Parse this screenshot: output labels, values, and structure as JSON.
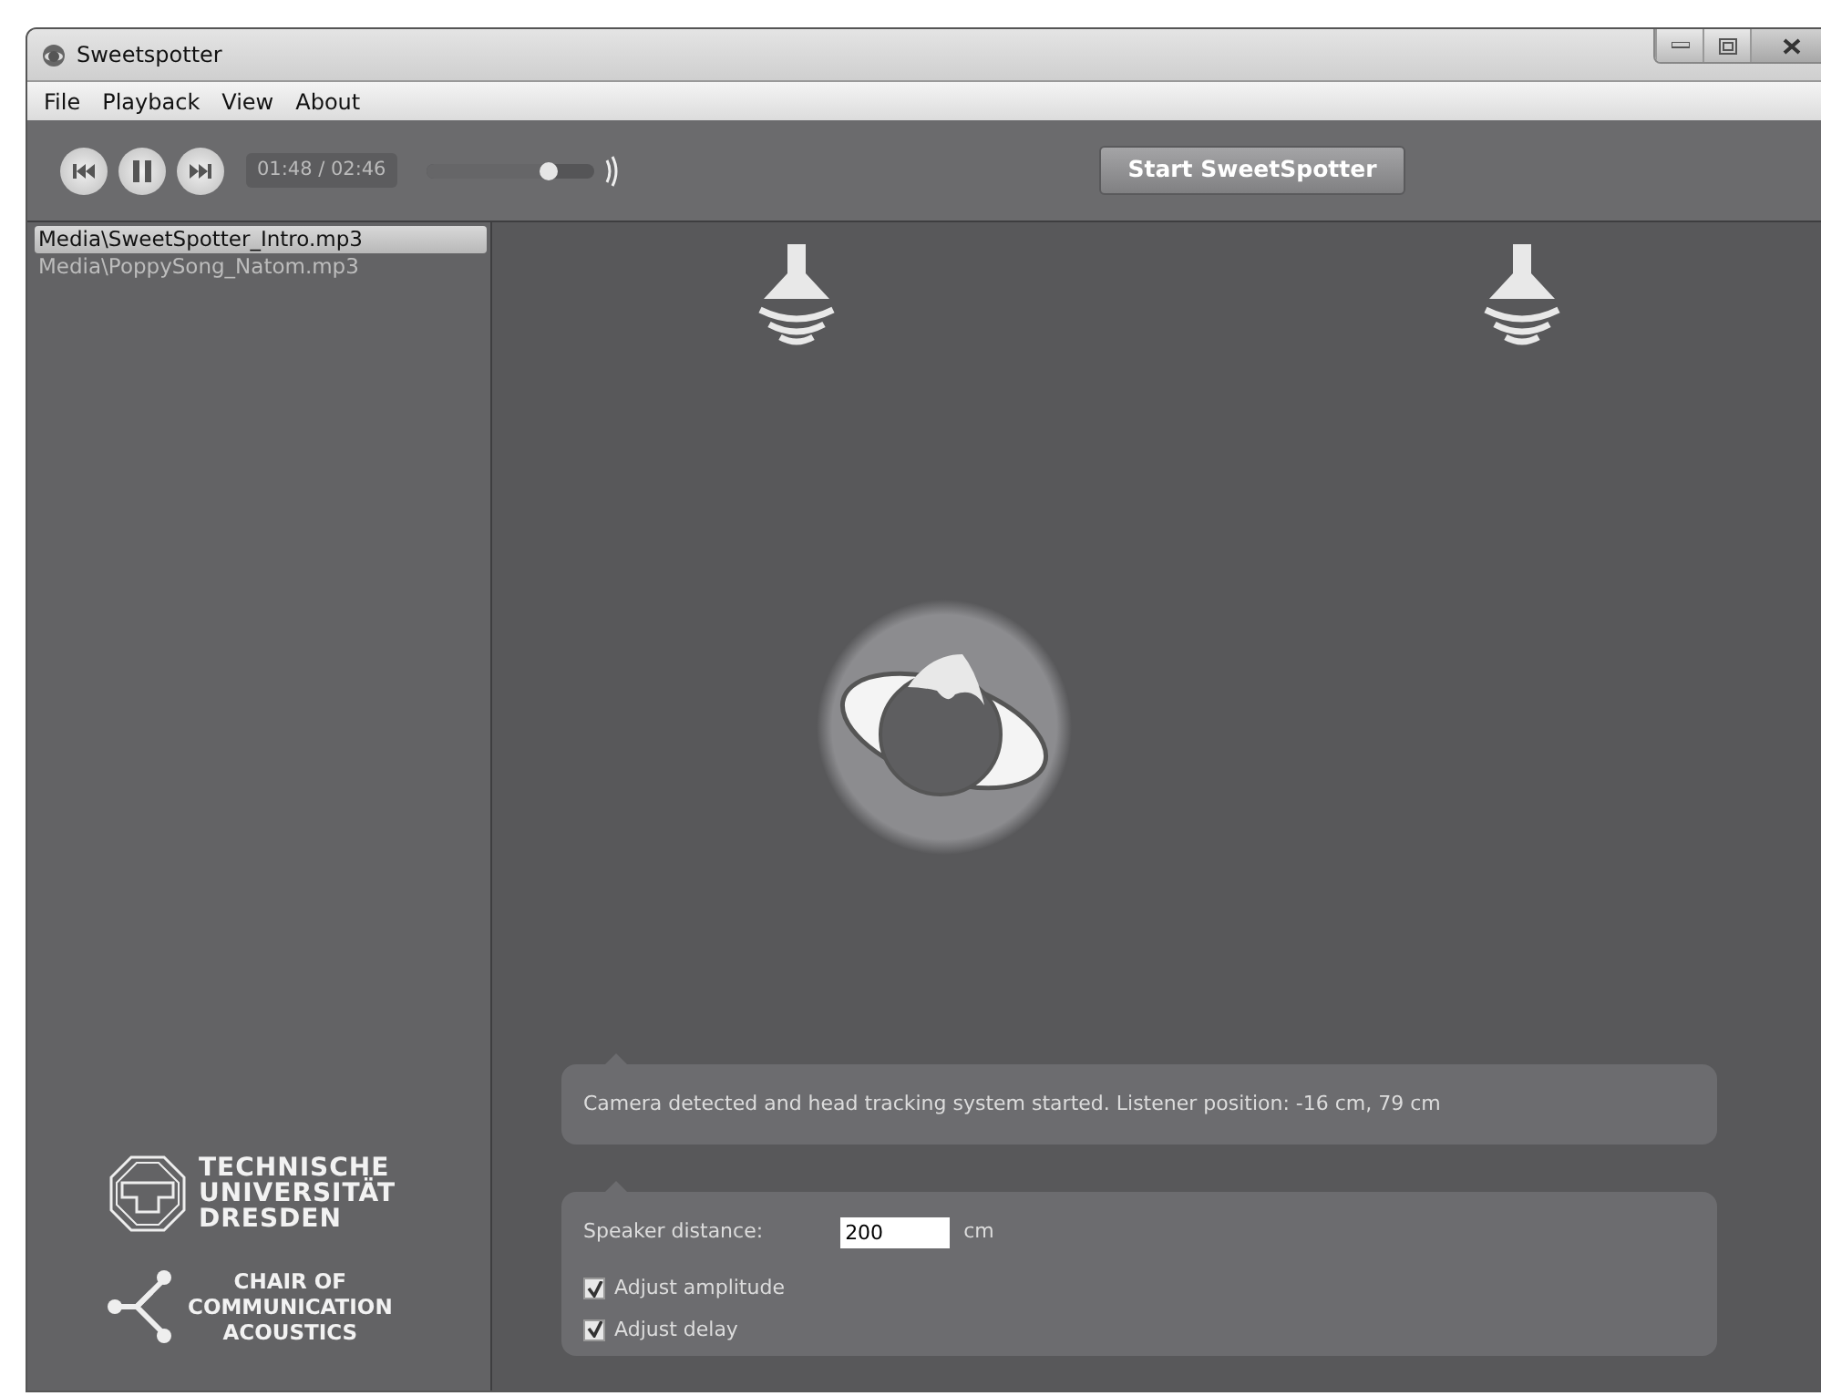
{
  "window": {
    "title": "Sweetspotter"
  },
  "menu": [
    {
      "label": "File"
    },
    {
      "label": "Playback"
    },
    {
      "label": "View"
    },
    {
      "label": "About"
    }
  ],
  "player": {
    "time": "01:48 / 02:46",
    "volume": {
      "level": 0.73
    }
  },
  "start_button": {
    "label": "Start SweetSpotter"
  },
  "playlist": [
    {
      "label": "Media\\SweetSpotter_Intro.mp3",
      "selected": true
    },
    {
      "label": "Media\\PoppySong_Natom.mp3",
      "selected": false
    }
  ],
  "logos": {
    "university": [
      "TECHNISCHE",
      "UNIVERSITÄT",
      "DRESDEN"
    ],
    "chair": [
      "CHAIR OF",
      "COMMUNICATION",
      "ACOUSTICS"
    ]
  },
  "status_message": "Camera detected and head tracking system started. Listener position: -16 cm, 79 cm",
  "settings": {
    "speaker_distance": {
      "label": "Speaker distance:",
      "value": "200",
      "unit": "cm"
    },
    "options": [
      {
        "label": "Adjust amplitude",
        "checked": true
      },
      {
        "label": "Adjust delay",
        "checked": true
      }
    ]
  }
}
